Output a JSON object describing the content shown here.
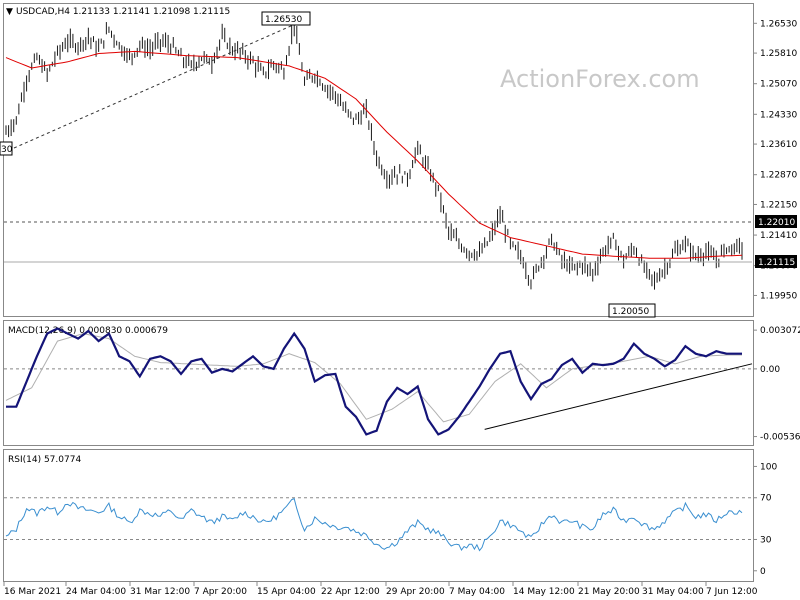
{
  "watermark": "ActionForex.com",
  "chart_data": [
    {
      "type": "candlestick",
      "title": "USDCAD,H4  1.21133 1.21141 1.21098 1.21115",
      "ylim": [
        1.1955,
        1.269
      ],
      "y_ticks": [
        "1.26530",
        "1.25810",
        "1.25070",
        "1.24330",
        "1.23610",
        "1.22870",
        "1.22150",
        "1.21410",
        "1.20670",
        "1.19950"
      ],
      "x_ticks": [
        "16 Mar 2021",
        "24 Mar 04:00",
        "31 Mar 12:00",
        "7 Apr 20:00",
        "15 Apr 04:00",
        "22 Apr 12:00",
        "29 Apr 20:00",
        "7 May 04:00",
        "14 May 12:00",
        "21 May 20:00",
        "31 May 04:00",
        "7 Jun 12:00"
      ],
      "annotations": [
        "1.26530",
        "1.20050",
        "1.22010"
      ],
      "left_partial_label": "30",
      "current_price_label": "1.21115",
      "close_path": [
        [
          0,
          1.239
        ],
        [
          4,
          1.242
        ],
        [
          8,
          1.252
        ],
        [
          12,
          1.257
        ],
        [
          16,
          1.253
        ],
        [
          20,
          1.258
        ],
        [
          24,
          1.261
        ],
        [
          28,
          1.26
        ],
        [
          32,
          1.262
        ],
        [
          36,
          1.259
        ],
        [
          40,
          1.264
        ],
        [
          44,
          1.26
        ],
        [
          48,
          1.257
        ],
        [
          52,
          1.26
        ],
        [
          56,
          1.259
        ],
        [
          60,
          1.261
        ],
        [
          64,
          1.26
        ],
        [
          68,
          1.257
        ],
        [
          72,
          1.255
        ],
        [
          76,
          1.257
        ],
        [
          80,
          1.256
        ],
        [
          84,
          1.262
        ],
        [
          88,
          1.259
        ],
        [
          92,
          1.258
        ],
        [
          96,
          1.256
        ],
        [
          100,
          1.253
        ],
        [
          104,
          1.2555
        ],
        [
          108,
          1.254
        ],
        [
          112,
          1.265
        ],
        [
          116,
          1.251
        ],
        [
          120,
          1.253
        ],
        [
          124,
          1.25
        ],
        [
          128,
          1.248
        ],
        [
          132,
          1.244
        ],
        [
          136,
          1.242
        ],
        [
          140,
          1.244
        ],
        [
          144,
          1.233
        ],
        [
          148,
          1.228
        ],
        [
          152,
          1.229
        ],
        [
          156,
          1.228
        ],
        [
          160,
          1.235
        ],
        [
          164,
          1.23
        ],
        [
          168,
          1.225
        ],
        [
          172,
          1.215
        ],
        [
          176,
          1.212
        ],
        [
          180,
          1.21
        ],
        [
          184,
          1.2095
        ],
        [
          188,
          1.213
        ],
        [
          192,
          1.219
        ],
        [
          196,
          1.212
        ],
        [
          200,
          1.209
        ],
        [
          204,
          1.203
        ],
        [
          208,
          1.208
        ],
        [
          212,
          1.213
        ],
        [
          216,
          1.208
        ],
        [
          220,
          1.206
        ],
        [
          224,
          1.207
        ],
        [
          228,
          1.205
        ],
        [
          232,
          1.21
        ],
        [
          236,
          1.213
        ],
        [
          240,
          1.208
        ],
        [
          244,
          1.211
        ],
        [
          248,
          1.206
        ],
        [
          252,
          1.203
        ],
        [
          256,
          1.206
        ],
        [
          260,
          1.21
        ],
        [
          264,
          1.212
        ],
        [
          268,
          1.209
        ],
        [
          272,
          1.21
        ],
        [
          276,
          1.208
        ],
        [
          280,
          1.211
        ],
        [
          286,
          1.21115
        ]
      ],
      "ma_path": [
        [
          0,
          1.257
        ],
        [
          10,
          1.2545
        ],
        [
          24,
          1.256
        ],
        [
          36,
          1.258
        ],
        [
          50,
          1.2585
        ],
        [
          70,
          1.2575
        ],
        [
          90,
          1.257
        ],
        [
          110,
          1.255
        ],
        [
          124,
          1.252
        ],
        [
          136,
          1.247
        ],
        [
          148,
          1.239
        ],
        [
          160,
          1.232
        ],
        [
          172,
          1.224
        ],
        [
          184,
          1.217
        ],
        [
          196,
          1.2135
        ],
        [
          210,
          1.2115
        ],
        [
          224,
          1.2095
        ],
        [
          236,
          1.209
        ],
        [
          250,
          1.2085
        ],
        [
          264,
          1.2085
        ],
        [
          276,
          1.209
        ],
        [
          286,
          1.2092
        ]
      ]
    },
    {
      "type": "line",
      "title": "MACD(12,26,9) 0.000830 0.000679",
      "ylim": [
        -0.0058,
        0.0034
      ],
      "y_ticks": [
        "0.003072",
        "0.00",
        "-0.005369"
      ],
      "series": [
        {
          "values": [
            [
              0,
              -0.003
            ],
            [
              4,
              -0.003
            ],
            [
              8,
              -0.001
            ],
            [
              12,
              0.001
            ],
            [
              16,
              0.0028
            ],
            [
              20,
              0.0032
            ],
            [
              24,
              0.0028
            ],
            [
              28,
              0.0024
            ],
            [
              32,
              0.003
            ],
            [
              36,
              0.0022
            ],
            [
              40,
              0.0028
            ],
            [
              44,
              0.001
            ],
            [
              48,
              0.0006
            ],
            [
              52,
              -0.0006
            ],
            [
              56,
              0.0008
            ],
            [
              60,
              0.001
            ],
            [
              64,
              0.0006
            ],
            [
              68,
              -0.0004
            ],
            [
              72,
              0.0006
            ],
            [
              76,
              0.0008
            ],
            [
              80,
              -0.0003
            ],
            [
              84,
              0.0
            ],
            [
              88,
              -0.0002
            ],
            [
              92,
              0.0004
            ],
            [
              96,
              0.001
            ],
            [
              100,
              0.0002
            ],
            [
              104,
              0.0
            ],
            [
              108,
              0.0016
            ],
            [
              112,
              0.0028
            ],
            [
              116,
              0.0016
            ],
            [
              120,
              -0.001
            ],
            [
              124,
              -0.0005
            ],
            [
              128,
              -0.0004
            ],
            [
              132,
              -0.003
            ],
            [
              136,
              -0.0038
            ],
            [
              140,
              -0.0052
            ],
            [
              144,
              -0.0049
            ],
            [
              148,
              -0.0026
            ],
            [
              152,
              -0.0015
            ],
            [
              156,
              -0.002
            ],
            [
              160,
              -0.0014
            ],
            [
              164,
              -0.004
            ],
            [
              168,
              -0.0052
            ],
            [
              172,
              -0.0048
            ],
            [
              176,
              -0.0038
            ],
            [
              180,
              -0.0026
            ],
            [
              184,
              -0.0014
            ],
            [
              188,
              0.0
            ],
            [
              192,
              0.0012
            ],
            [
              196,
              0.0014
            ],
            [
              200,
              -0.001
            ],
            [
              204,
              -0.0024
            ],
            [
              208,
              -0.0012
            ],
            [
              212,
              -0.0008
            ],
            [
              216,
              0.0003
            ],
            [
              220,
              0.0008
            ],
            [
              224,
              -0.0003
            ],
            [
              228,
              0.0004
            ],
            [
              232,
              0.0003
            ],
            [
              236,
              0.0004
            ],
            [
              240,
              0.0008
            ],
            [
              244,
              0.002
            ],
            [
              248,
              0.0012
            ],
            [
              252,
              0.0008
            ],
            [
              256,
              0.0002
            ],
            [
              260,
              0.0007
            ],
            [
              264,
              0.0018
            ],
            [
              268,
              0.0012
            ],
            [
              272,
              0.001
            ],
            [
              276,
              0.0014
            ],
            [
              280,
              0.0012
            ],
            [
              286,
              0.0012
            ]
          ]
        },
        {
          "values": [
            [
              0,
              -0.0025
            ],
            [
              10,
              -0.0015
            ],
            [
              20,
              0.0022
            ],
            [
              30,
              0.0028
            ],
            [
              40,
              0.0024
            ],
            [
              50,
              0.001
            ],
            [
              60,
              0.0005
            ],
            [
              70,
              0.0004
            ],
            [
              80,
              0.0003
            ],
            [
              90,
              0.0002
            ],
            [
              100,
              0.0004
            ],
            [
              110,
              0.0012
            ],
            [
              120,
              0.0005
            ],
            [
              130,
              -0.0012
            ],
            [
              140,
              -0.004
            ],
            [
              150,
              -0.0032
            ],
            [
              160,
              -0.0018
            ],
            [
              170,
              -0.0042
            ],
            [
              180,
              -0.0036
            ],
            [
              190,
              -0.001
            ],
            [
              200,
              0.0004
            ],
            [
              210,
              -0.0015
            ],
            [
              220,
              0.0
            ],
            [
              230,
              0.0003
            ],
            [
              240,
              0.0006
            ],
            [
              250,
              0.001
            ],
            [
              260,
              0.0004
            ],
            [
              270,
              0.001
            ],
            [
              280,
              0.0011
            ],
            [
              286,
              0.0011
            ]
          ]
        }
      ],
      "trend_line": [
        [
          186,
          -0.0048
        ],
        [
          300,
          0.0004
        ]
      ]
    },
    {
      "type": "line",
      "title": "RSI(14) 57.0774",
      "ylim": [
        -5,
        110
      ],
      "y_ticks": [
        "100",
        "70",
        "30",
        "0"
      ],
      "levels": [
        70,
        30
      ],
      "values": [
        [
          0,
          32
        ],
        [
          4,
          40
        ],
        [
          8,
          60
        ],
        [
          12,
          55
        ],
        [
          16,
          62
        ],
        [
          20,
          56
        ],
        [
          24,
          66
        ],
        [
          28,
          60
        ],
        [
          32,
          58
        ],
        [
          36,
          56
        ],
        [
          40,
          62
        ],
        [
          44,
          52
        ],
        [
          48,
          46
        ],
        [
          52,
          58
        ],
        [
          56,
          55
        ],
        [
          60,
          52
        ],
        [
          64,
          58
        ],
        [
          68,
          48
        ],
        [
          72,
          58
        ],
        [
          76,
          52
        ],
        [
          80,
          46
        ],
        [
          84,
          52
        ],
        [
          88,
          48
        ],
        [
          92,
          56
        ],
        [
          96,
          52
        ],
        [
          100,
          46
        ],
        [
          104,
          50
        ],
        [
          108,
          58
        ],
        [
          112,
          68
        ],
        [
          116,
          40
        ],
        [
          120,
          50
        ],
        [
          124,
          46
        ],
        [
          128,
          42
        ],
        [
          132,
          42
        ],
        [
          136,
          38
        ],
        [
          140,
          34
        ],
        [
          144,
          26
        ],
        [
          148,
          22
        ],
        [
          152,
          28
        ],
        [
          156,
          38
        ],
        [
          160,
          46
        ],
        [
          164,
          40
        ],
        [
          168,
          36
        ],
        [
          172,
          28
        ],
        [
          176,
          22
        ],
        [
          180,
          24
        ],
        [
          184,
          22
        ],
        [
          188,
          32
        ],
        [
          192,
          48
        ],
        [
          196,
          44
        ],
        [
          200,
          38
        ],
        [
          204,
          30
        ],
        [
          208,
          44
        ],
        [
          212,
          54
        ],
        [
          216,
          46
        ],
        [
          220,
          48
        ],
        [
          224,
          42
        ],
        [
          228,
          40
        ],
        [
          232,
          54
        ],
        [
          236,
          58
        ],
        [
          240,
          48
        ],
        [
          244,
          52
        ],
        [
          248,
          44
        ],
        [
          252,
          40
        ],
        [
          256,
          48
        ],
        [
          260,
          56
        ],
        [
          264,
          62
        ],
        [
          268,
          52
        ],
        [
          272,
          54
        ],
        [
          276,
          48
        ],
        [
          280,
          56
        ],
        [
          286,
          57
        ]
      ]
    }
  ]
}
